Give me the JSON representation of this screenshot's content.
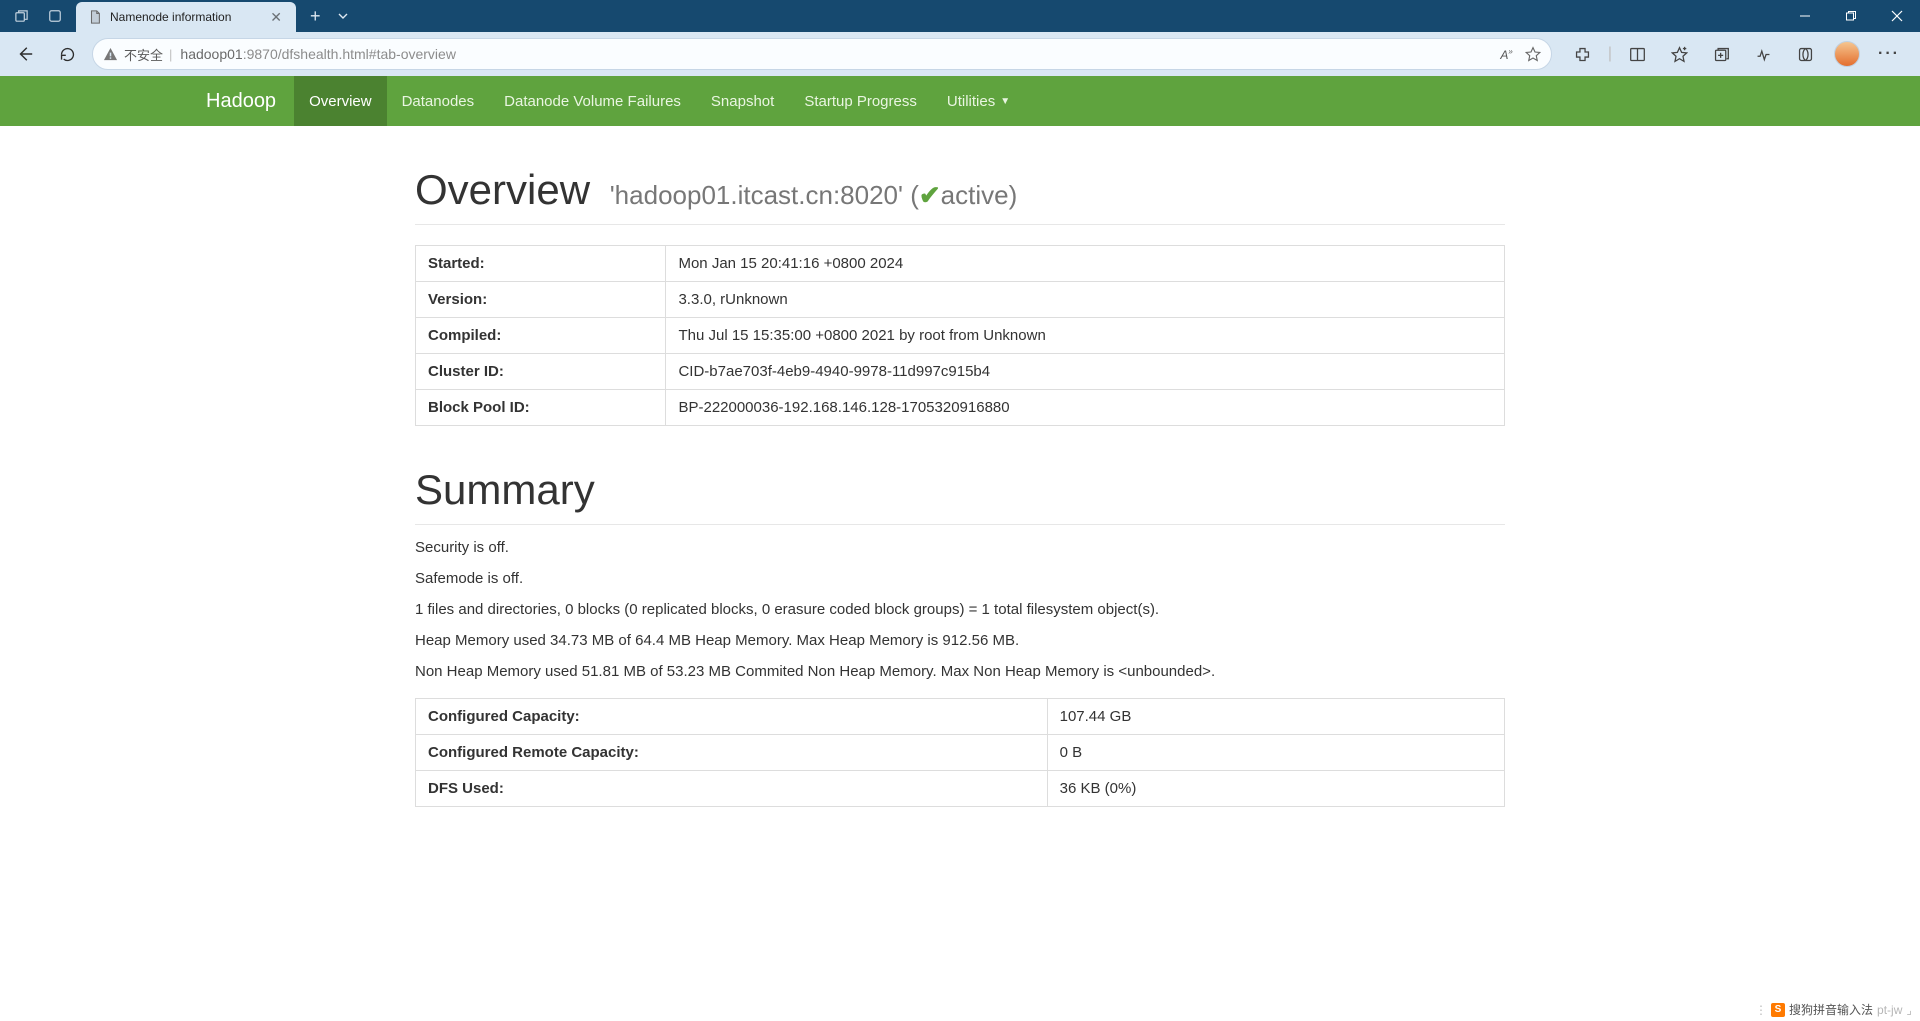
{
  "browser": {
    "tab_title": "Namenode information",
    "security_label": "不安全",
    "url_host": "hadoop01",
    "url_port_path": ":9870/dfshealth.html#tab-overview"
  },
  "nav": {
    "brand": "Hadoop",
    "items": [
      "Overview",
      "Datanodes",
      "Datanode Volume Failures",
      "Snapshot",
      "Startup Progress",
      "Utilities"
    ]
  },
  "overview": {
    "heading": "Overview",
    "host": "'hadoop01.itcast.cn:8020'",
    "status": "active",
    "rows": [
      {
        "k": "Started:",
        "v": "Mon Jan 15 20:41:16 +0800 2024"
      },
      {
        "k": "Version:",
        "v": "3.3.0, rUnknown"
      },
      {
        "k": "Compiled:",
        "v": "Thu Jul 15 15:35:00 +0800 2021 by root from Unknown"
      },
      {
        "k": "Cluster ID:",
        "v": "CID-b7ae703f-4eb9-4940-9978-11d997c915b4"
      },
      {
        "k": "Block Pool ID:",
        "v": "BP-222000036-192.168.146.128-1705320916880"
      }
    ]
  },
  "summary": {
    "heading": "Summary",
    "lines": [
      "Security is off.",
      "Safemode is off.",
      "1 files and directories, 0 blocks (0 replicated blocks, 0 erasure coded block groups) = 1 total filesystem object(s).",
      "Heap Memory used 34.73 MB of 64.4 MB Heap Memory. Max Heap Memory is 912.56 MB.",
      "Non Heap Memory used 51.81 MB of 53.23 MB Commited Non Heap Memory. Max Non Heap Memory is <unbounded>."
    ],
    "rows": [
      {
        "k": "Configured Capacity:",
        "v": "107.44 GB"
      },
      {
        "k": "Configured Remote Capacity:",
        "v": "0 B"
      },
      {
        "k": "DFS Used:",
        "v": "36 KB (0%)"
      }
    ]
  },
  "ime": {
    "text": "搜狗拼音输入法",
    "faded": "pt-jw"
  }
}
